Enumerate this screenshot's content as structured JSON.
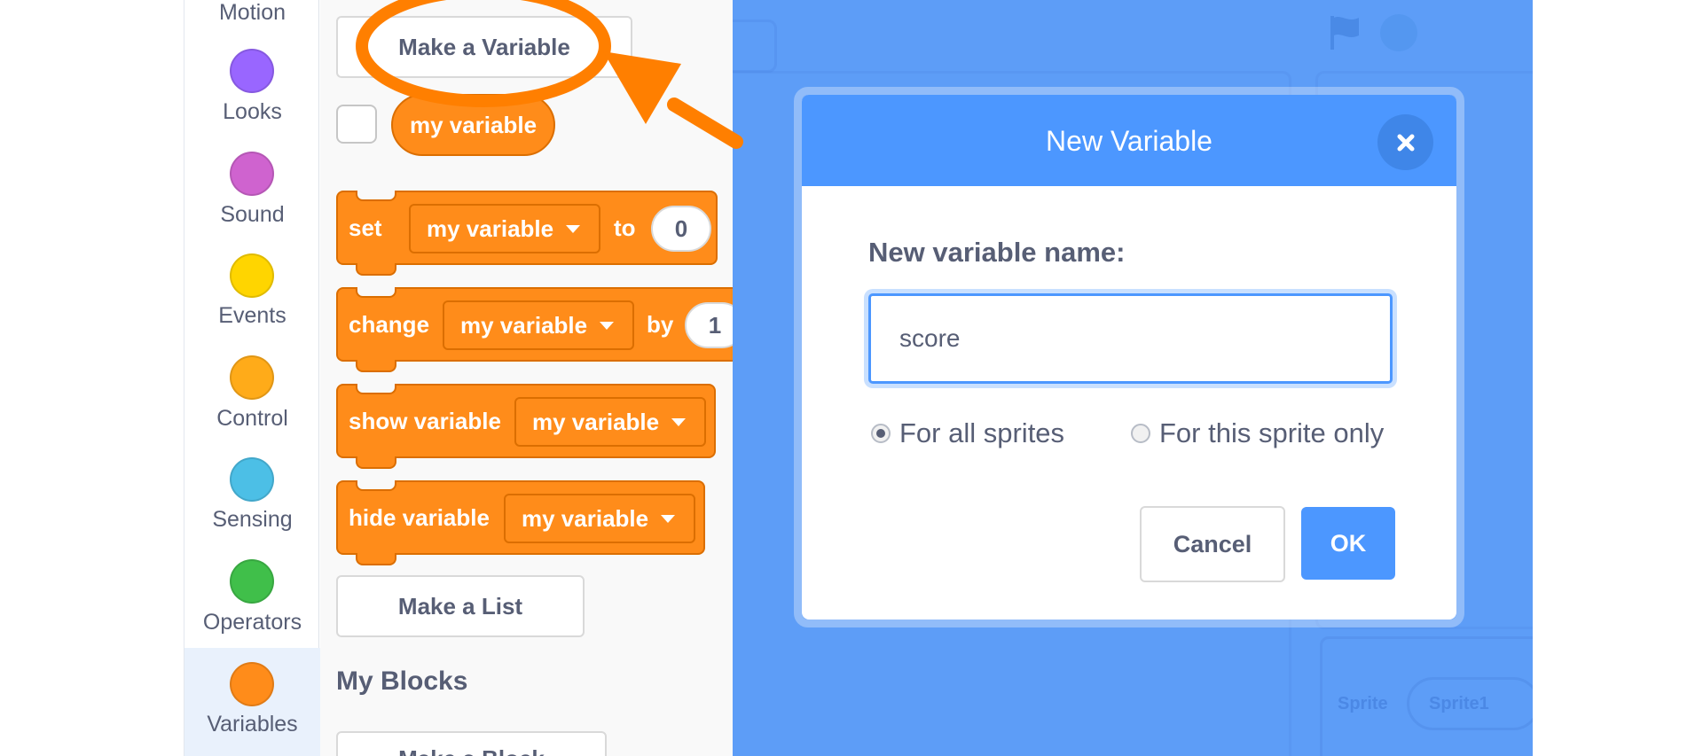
{
  "categories": [
    {
      "label": "Motion",
      "color": "#4c97ff",
      "icon": "motion-dot-icon"
    },
    {
      "label": "Looks",
      "color": "#9966ff",
      "icon": "looks-dot-icon"
    },
    {
      "label": "Sound",
      "color": "#cf63cf",
      "icon": "sound-dot-icon"
    },
    {
      "label": "Events",
      "color": "#ffd500",
      "icon": "events-dot-icon"
    },
    {
      "label": "Control",
      "color": "#ffab19",
      "icon": "control-dot-icon"
    },
    {
      "label": "Sensing",
      "color": "#4cbfe6",
      "icon": "sensing-dot-icon"
    },
    {
      "label": "Operators",
      "color": "#40bf4a",
      "icon": "operators-dot-icon"
    },
    {
      "label": "Variables",
      "color": "#ff8c1a",
      "icon": "variables-dot-icon",
      "selected": true
    }
  ],
  "palette": {
    "make_variable": "Make a Variable",
    "reporter": "my variable",
    "set_block": {
      "verb": "set",
      "var": "my variable",
      "prep": "to",
      "value": "0"
    },
    "change_block": {
      "verb": "change",
      "var": "my variable",
      "prep": "by",
      "value": "1"
    },
    "show_block": {
      "verb": "show variable",
      "var": "my variable"
    },
    "hide_block": {
      "verb": "hide variable",
      "var": "my variable"
    },
    "make_list": "Make a List",
    "my_blocks_heading": "My Blocks",
    "make_block": "Make a Block"
  },
  "background": {
    "sprite_label": "Sprite",
    "sprite_name": "Sprite1"
  },
  "modal": {
    "title": "New Variable",
    "field_label": "New variable name:",
    "input_value": "score",
    "option_all": "For all sprites",
    "option_this": "For this sprite only",
    "selected_option": "For all sprites",
    "cancel": "Cancel",
    "ok": "OK"
  },
  "colors": {
    "accent": "#4c97ff",
    "variables": "#ff8c1a",
    "overlay": "#5d9df7",
    "annotation": "#ff7f00"
  }
}
